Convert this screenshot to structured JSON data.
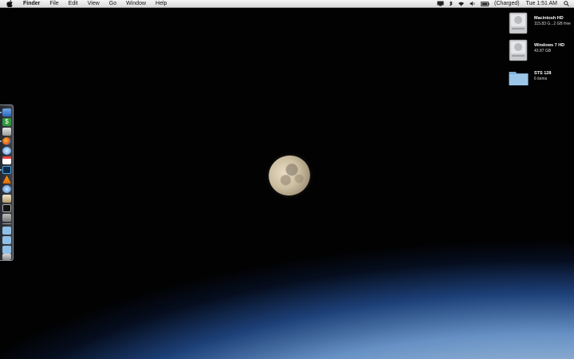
{
  "menubar": {
    "apple_icon": "apple-icon",
    "app_name": "Finder",
    "items": [
      "File",
      "Edit",
      "View",
      "Go",
      "Window",
      "Help"
    ],
    "battery_status": "(Charged)",
    "clock": "Tue 1:51 AM",
    "status_icons": [
      "screen-icon",
      "bluetooth-icon",
      "wifi-icon",
      "volume-icon",
      "battery-icon",
      "spotlight-icon"
    ]
  },
  "desktop_items": [
    {
      "name": "Macintosh HD",
      "detail": "115.83 G...2 GB free",
      "icon": "hard-drive-icon"
    },
    {
      "name": "Windows 7 HD",
      "detail": "43.87 GB",
      "icon": "hard-drive-icon"
    },
    {
      "name": "STS 128",
      "detail": "6 items",
      "icon": "folder-icon"
    }
  ],
  "dock": {
    "position": "left",
    "items": [
      "finder-icon",
      "dollar-app-icon",
      "preview-icon",
      "firefox-icon",
      "safari-icon",
      "calendar-icon",
      "photoshop-icon",
      "vlc-icon",
      "itunes-icon",
      "chess-icon",
      "terminal-icon",
      "utility-icon",
      "folder-icon",
      "folder-icon",
      "folder-icon",
      "trash-icon"
    ]
  },
  "colors": {
    "menubar_bg": "#e8e8e8",
    "earth_glow": "#9cc8f2",
    "space": "#020203"
  }
}
